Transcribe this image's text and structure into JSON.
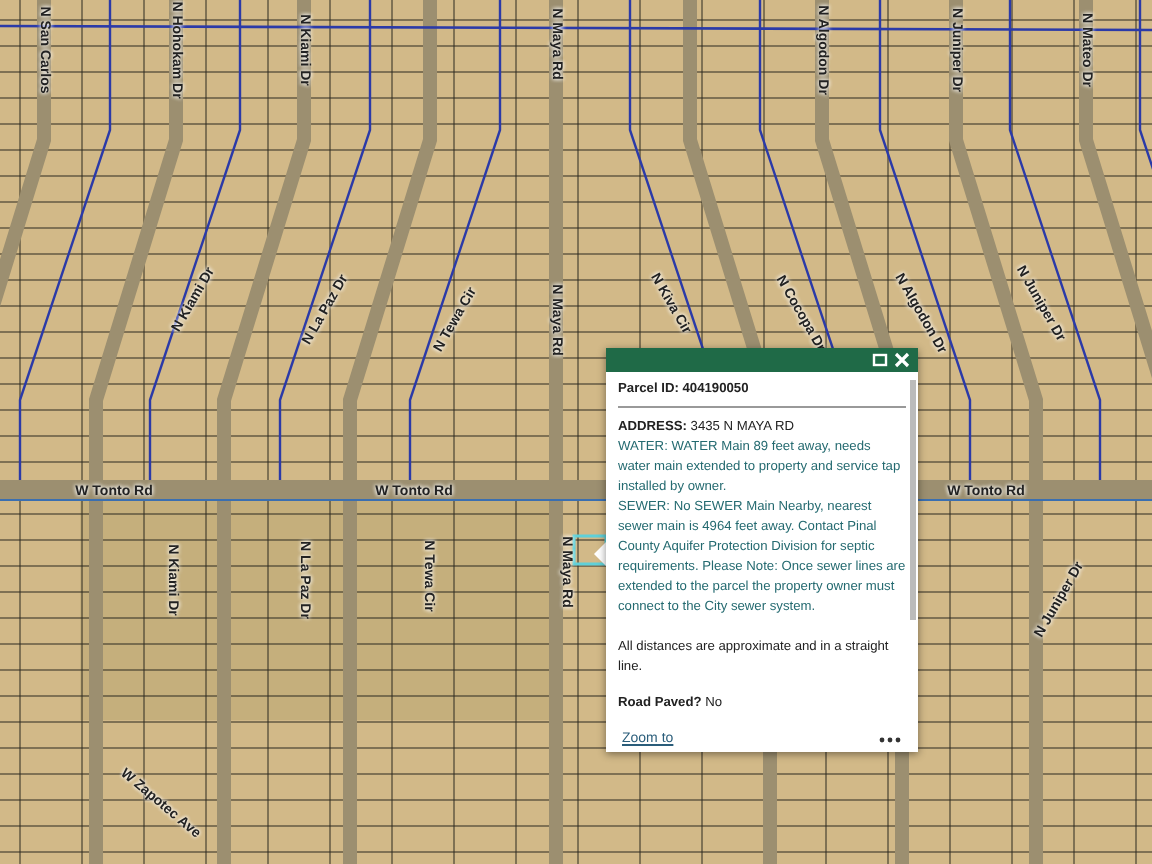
{
  "map": {
    "street_labels": [
      {
        "text": "N San Carlos"
      },
      {
        "text": "N Hohokam Dr"
      },
      {
        "text": "N Kiami Dr"
      },
      {
        "text": "N Maya Rd"
      },
      {
        "text": "N Algodon Dr"
      },
      {
        "text": "N Juniper Dr"
      },
      {
        "text": "N Mateo Dr"
      },
      {
        "text": "N Kiami Dr"
      },
      {
        "text": "N La Paz Dr"
      },
      {
        "text": "N Tewa Cir"
      },
      {
        "text": "N Maya Rd"
      },
      {
        "text": "N Kiva Cir"
      },
      {
        "text": "N Cocopa Dr"
      },
      {
        "text": "N Algodon Dr"
      },
      {
        "text": "N Juniper Dr"
      },
      {
        "text": "W Tonto Rd"
      },
      {
        "text": "W Tonto Rd"
      },
      {
        "text": "W Tonto Rd"
      },
      {
        "text": "N Kiami Dr"
      },
      {
        "text": "N La Paz Dr"
      },
      {
        "text": "N Tewa Cir"
      },
      {
        "text": "N Maya Rd"
      },
      {
        "text": "W Zapotec Ave"
      },
      {
        "text": "N Juniper Dr"
      }
    ]
  },
  "popup": {
    "heading": "Parcel ID: 404190050",
    "address_label": "ADDRESS:",
    "address": "3435 N MAYA RD",
    "paragraphs": [
      {
        "kind": "utility",
        "text": "WATER: WATER Main 89 feet away, needs water main extended to property and service tap installed by owner."
      },
      {
        "kind": "utility",
        "text": "SEWER: No SEWER Main Nearby, nearest sewer main is 4964 feet away. Contact Pinal County Aquifer Protection Division for septic requirements. Please Note: Once sewer lines are extended to the parcel the property owner must connect to the City sewer system."
      },
      {
        "kind": "note",
        "text": "All distances are approximate and in a straight line."
      }
    ],
    "road_paved_label": "Road Paved?",
    "road_paved": "No",
    "zoom_link": "Zoom to"
  }
}
